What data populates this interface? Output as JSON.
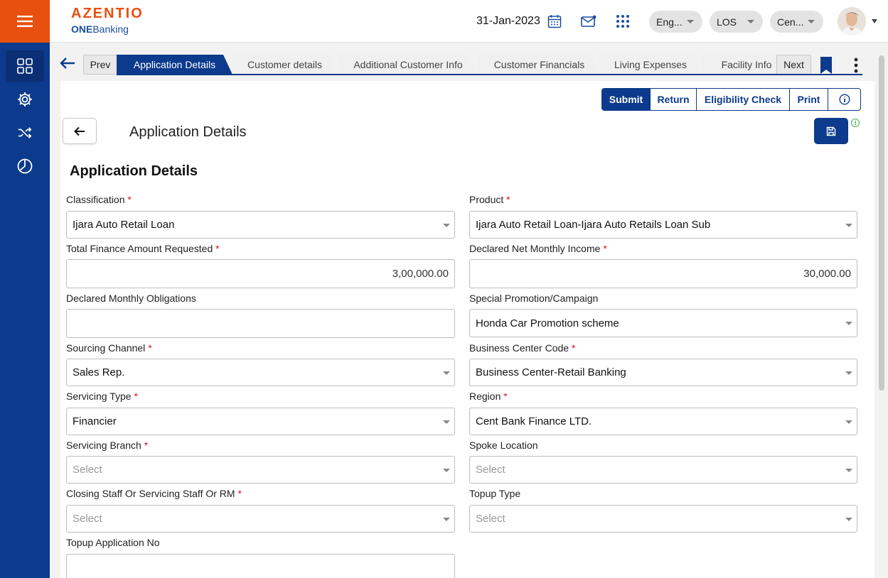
{
  "brand": {
    "name": "AZENTIO",
    "sub_bold": "ONE",
    "sub": "Banking",
    "accent": "#e8500f",
    "primary": "#0c3a8c"
  },
  "topbar": {
    "date": "31-Jan-2023",
    "language": "Eng...",
    "module": "LOS",
    "entity": "Cen..."
  },
  "rail": {
    "items": [
      "dashboard-icon",
      "settings-icon",
      "shuffle-icon",
      "pie-chart-icon"
    ]
  },
  "tabs": {
    "prev": "Prev",
    "next": "Next",
    "items": [
      {
        "label": "Application Details"
      },
      {
        "label": "Customer details"
      },
      {
        "label": "Additional Customer Info"
      },
      {
        "label": "Customer Financials"
      },
      {
        "label": "Living Expenses"
      },
      {
        "label": "Facility Info"
      }
    ]
  },
  "actions": {
    "submit": "Submit",
    "return": "Return",
    "eligibility": "Eligibility Check",
    "print": "Print"
  },
  "page": {
    "title": "Application Details",
    "section_title": "Application Details"
  },
  "form": {
    "classification": {
      "label": "Classification",
      "value": "Ijara Auto Retail Loan"
    },
    "product": {
      "label": "Product",
      "value": "Ijara Auto Retail Loan-Ijara Auto Retails Loan Sub"
    },
    "total_finance": {
      "label": "Total Finance Amount Requested",
      "value": "3,00,000.00"
    },
    "net_income": {
      "label": "Declared Net Monthly Income",
      "value": "30,000.00"
    },
    "obligations": {
      "label": "Declared Monthly Obligations",
      "value": ""
    },
    "promotion": {
      "label": "Special Promotion/Campaign",
      "value": "Honda Car Promotion scheme"
    },
    "sourcing": {
      "label": "Sourcing Channel",
      "value": "Sales Rep."
    },
    "business_center": {
      "label": "Business Center Code",
      "value": "Business Center-Retail Banking"
    },
    "servicing_type": {
      "label": "Servicing Type",
      "value": "Financier"
    },
    "region": {
      "label": "Region",
      "value": "Cent Bank Finance LTD."
    },
    "servicing_branch": {
      "label": "Servicing Branch",
      "placeholder": "Select"
    },
    "spoke_location": {
      "label": "Spoke Location",
      "placeholder": "Select"
    },
    "closing_staff": {
      "label": "Closing Staff Or Servicing Staff Or RM",
      "placeholder": "Select"
    },
    "topup_type": {
      "label": "Topup Type",
      "placeholder": "Select"
    },
    "topup_app_no": {
      "label": "Topup Application No",
      "value": ""
    }
  },
  "required_mark": "*"
}
